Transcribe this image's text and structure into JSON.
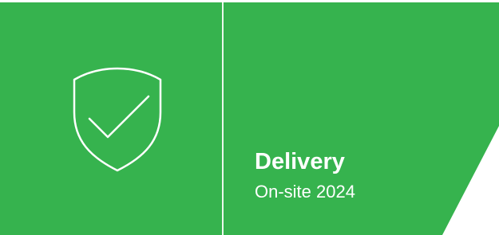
{
  "card": {
    "title": "Delivery",
    "subtitle": "On-site 2024",
    "icon": "shield-check-icon"
  },
  "colors": {
    "green": "#36b34e",
    "white": "#ffffff"
  }
}
